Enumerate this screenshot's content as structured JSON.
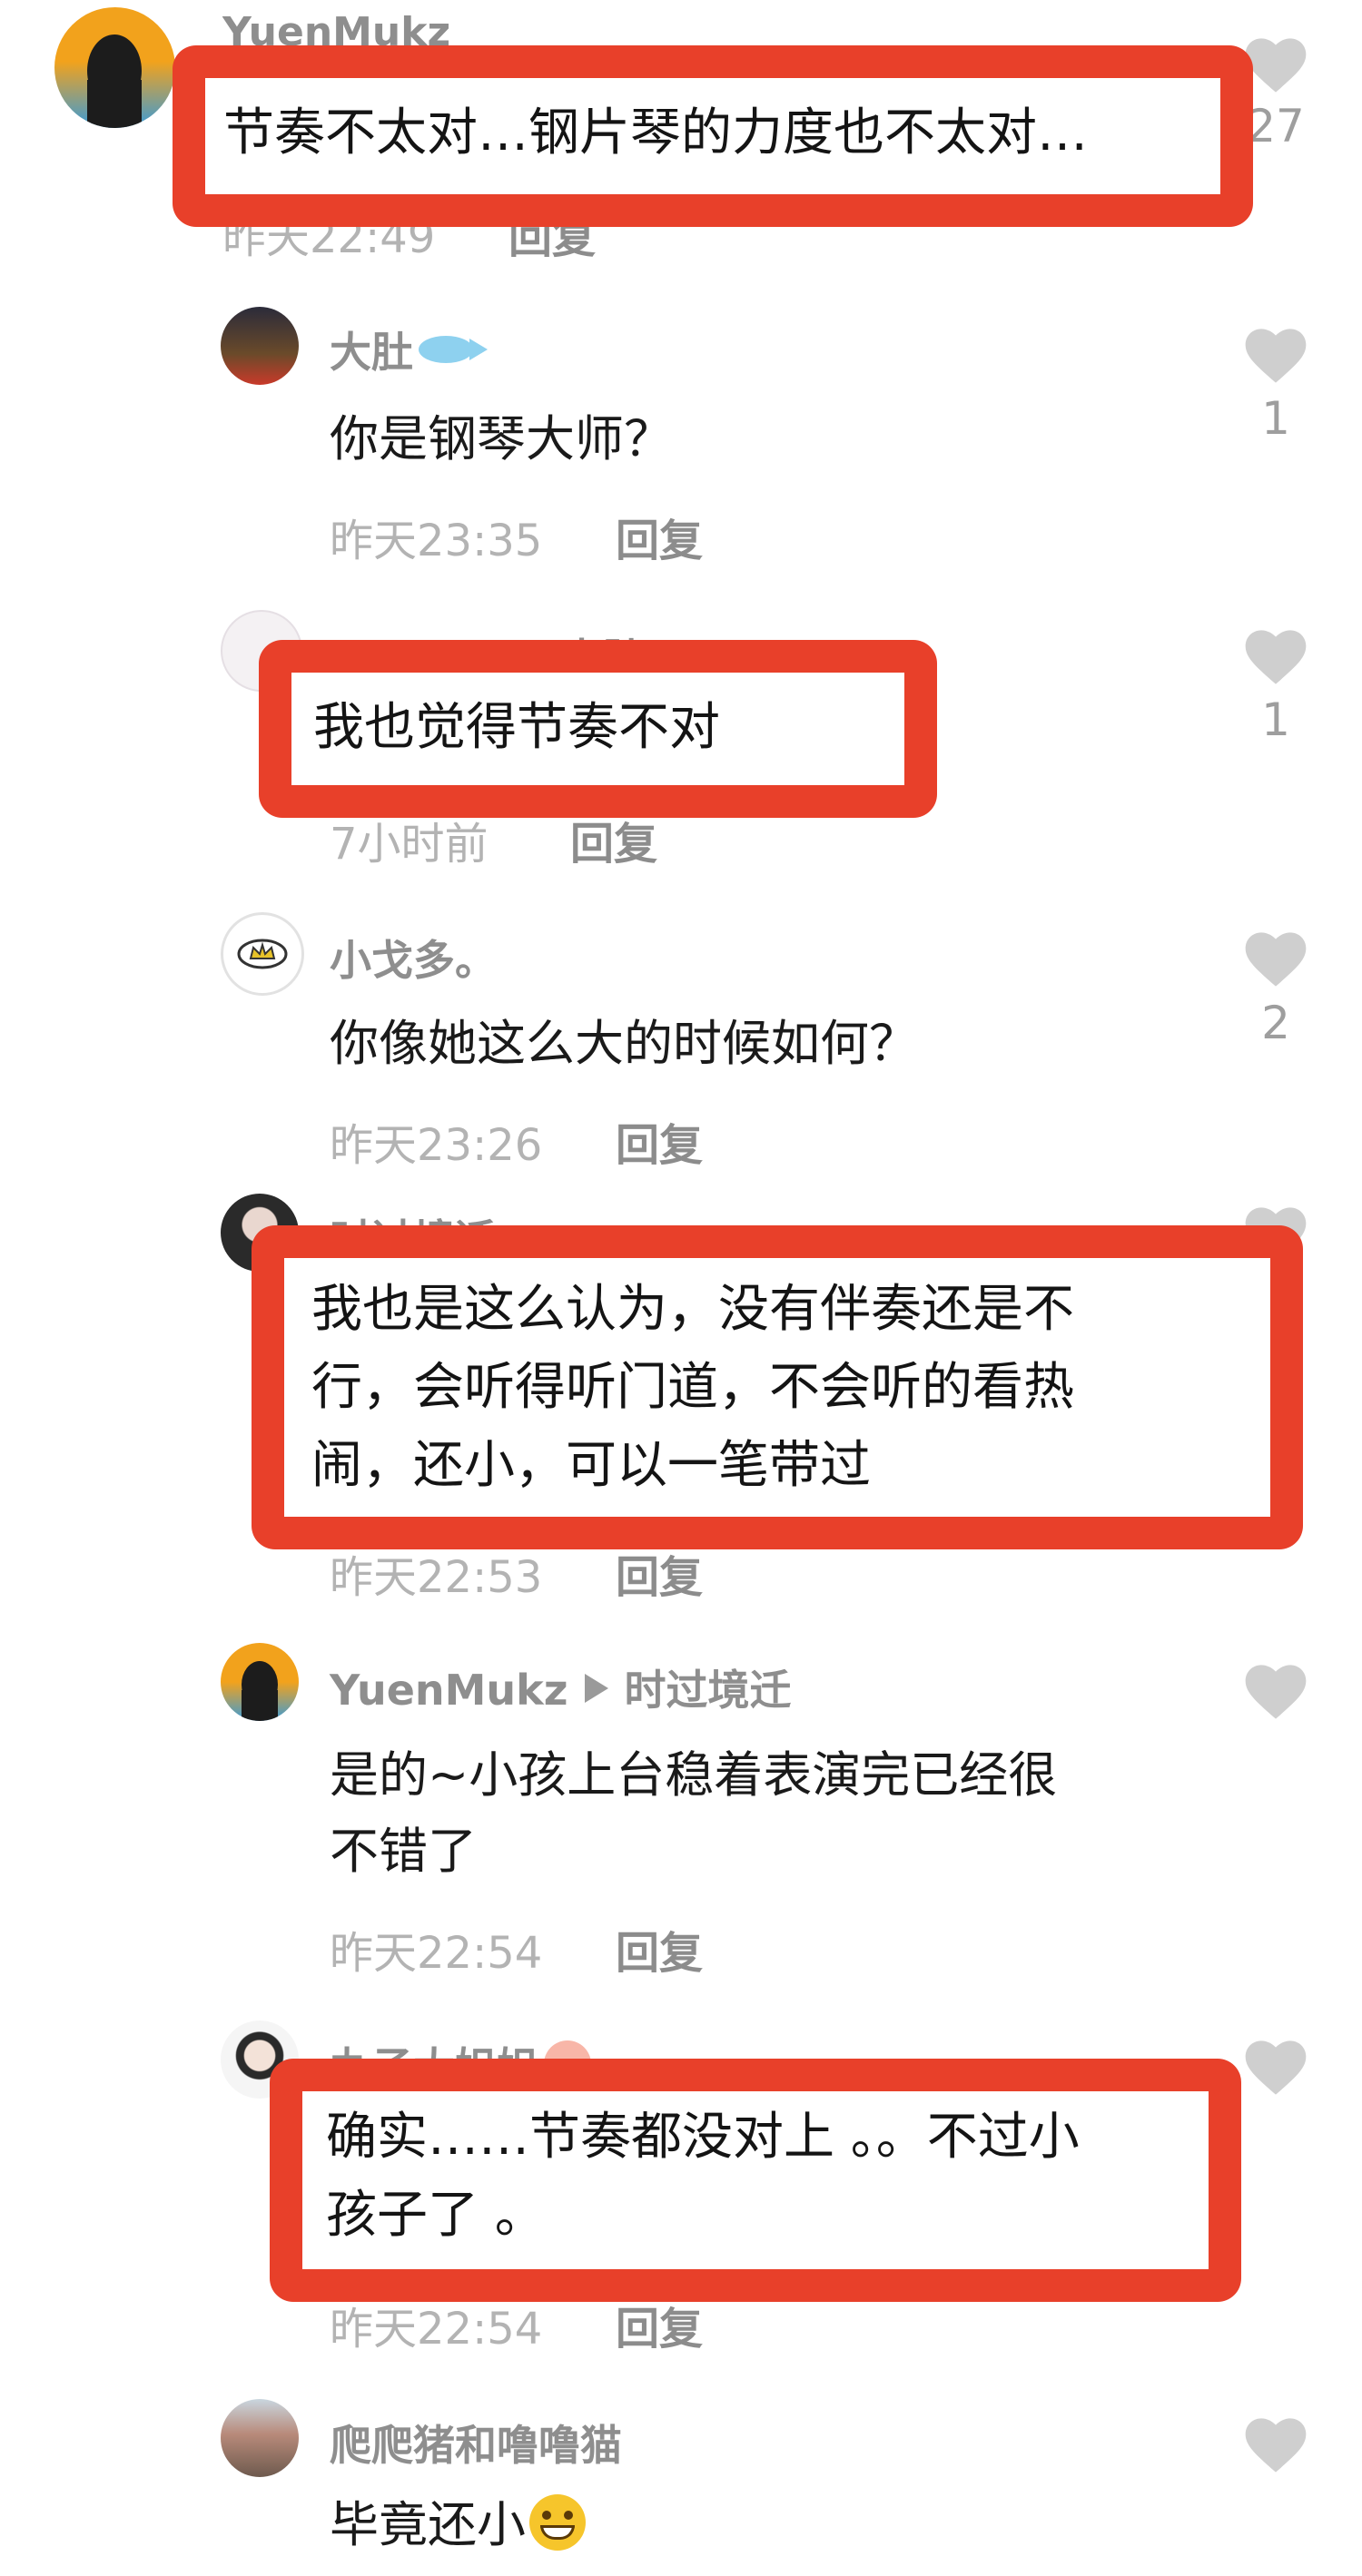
{
  "colors": {
    "highlight_border": "#e8402a",
    "name_gray": "#8e8e8e",
    "meta_gray": "#b3b3b3",
    "heart_gray": "#cfcfcf"
  },
  "comments": [
    {
      "user": "YuenMukz",
      "text": "节奏不太对…钢片琴的力度也不太对…",
      "time": "昨天22:49",
      "reply": "回复",
      "likes": "27"
    },
    {
      "user": "大肚",
      "text": "你是钢琴大师？",
      "time": "昨天23:35",
      "reply": "回复",
      "likes": "1"
    },
    {
      "user": "Sabrina ▸ 大肚",
      "text": "我也觉得节奏不对",
      "time": "7小时前",
      "reply": "回复",
      "likes": "1"
    },
    {
      "user": "小戈多。",
      "text": "你像她这么大的时候如何？",
      "time": "昨天23:26",
      "reply": "回复",
      "likes": "2"
    },
    {
      "user": "时过境迁",
      "text_lines": [
        "我也是这么认为，没有伴奏还是不",
        "行，会听得听门道，不会听的看热",
        "闹，还小，可以一笔带过"
      ],
      "time": "昨天22:53",
      "reply": "回复",
      "likes": ""
    },
    {
      "user": "YuenMukz",
      "reply_to": "时过境迁",
      "text_lines": [
        "是的~小孩上台稳着表演完已经很",
        "不错了"
      ],
      "time": "昨天22:54",
      "reply": "回复",
      "likes": ""
    },
    {
      "user": "丸子大姐姐",
      "text_lines": [
        "确实……节奏都没对上 。。不过小",
        "孩子了 。"
      ],
      "time": "昨天22:54",
      "reply": "回复",
      "likes": ""
    },
    {
      "user": "爬爬猪和噜噜猫",
      "text": "毕竟还小",
      "time": "",
      "reply": "",
      "likes": ""
    }
  ]
}
